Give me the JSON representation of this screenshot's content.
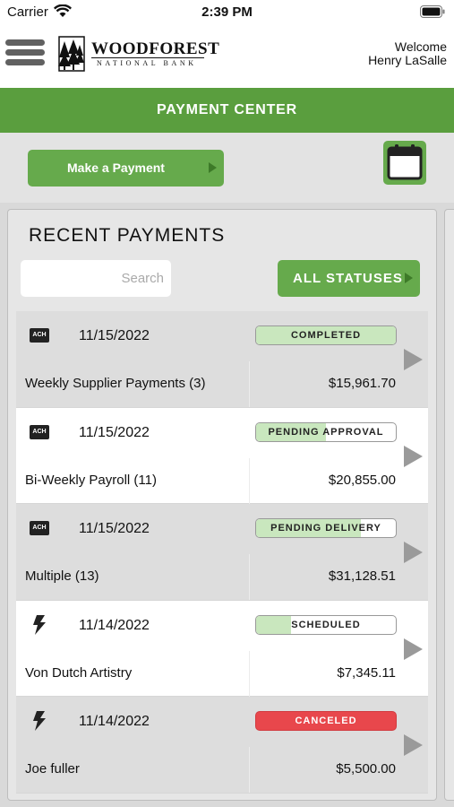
{
  "status_bar": {
    "carrier": "Carrier",
    "time": "2:39 PM",
    "icons": [
      "wifi-icon",
      "battery-icon"
    ]
  },
  "header": {
    "logo_text": "WOODFOREST",
    "logo_subtext": "NATIONAL BANK",
    "welcome": "Welcome",
    "user_name": "Henry LaSalle"
  },
  "title": "PAYMENT CENTER",
  "actions": {
    "make_payment": "Make a Payment",
    "calendar_icon": "calendar-icon"
  },
  "recent": {
    "title": "RECENT PAYMENTS",
    "search_placeholder": "Search",
    "filter_label": "ALL STATUSES"
  },
  "colors": {
    "brand_green": "#5a9e3e",
    "button_green": "#66aa4c",
    "status_fill": "#c9e7be",
    "canceled_red": "#e8474c"
  },
  "payments": [
    {
      "type": "ACH",
      "date": "11/15/2022",
      "status": "COMPLETED",
      "progress": 1.0,
      "name": "Weekly Supplier Payments (3)",
      "amount": "$15,961.70"
    },
    {
      "type": "ACH",
      "date": "11/15/2022",
      "status": "PENDING APPROVAL",
      "progress": 0.5,
      "name": "Bi-Weekly Payroll (11)",
      "amount": "$20,855.00"
    },
    {
      "type": "ACH",
      "date": "11/15/2022",
      "status": "PENDING DELIVERY",
      "progress": 0.75,
      "name": "Multiple (13)",
      "amount": "$31,128.51"
    },
    {
      "type": "wire",
      "date": "11/14/2022",
      "status": "SCHEDULED",
      "progress": 0.25,
      "name": "Von Dutch Artistry",
      "amount": "$7,345.11"
    },
    {
      "type": "wire",
      "date": "11/14/2022",
      "status": "CANCELED",
      "progress": 0,
      "name": "Joe fuller",
      "amount": "$5,500.00"
    }
  ]
}
